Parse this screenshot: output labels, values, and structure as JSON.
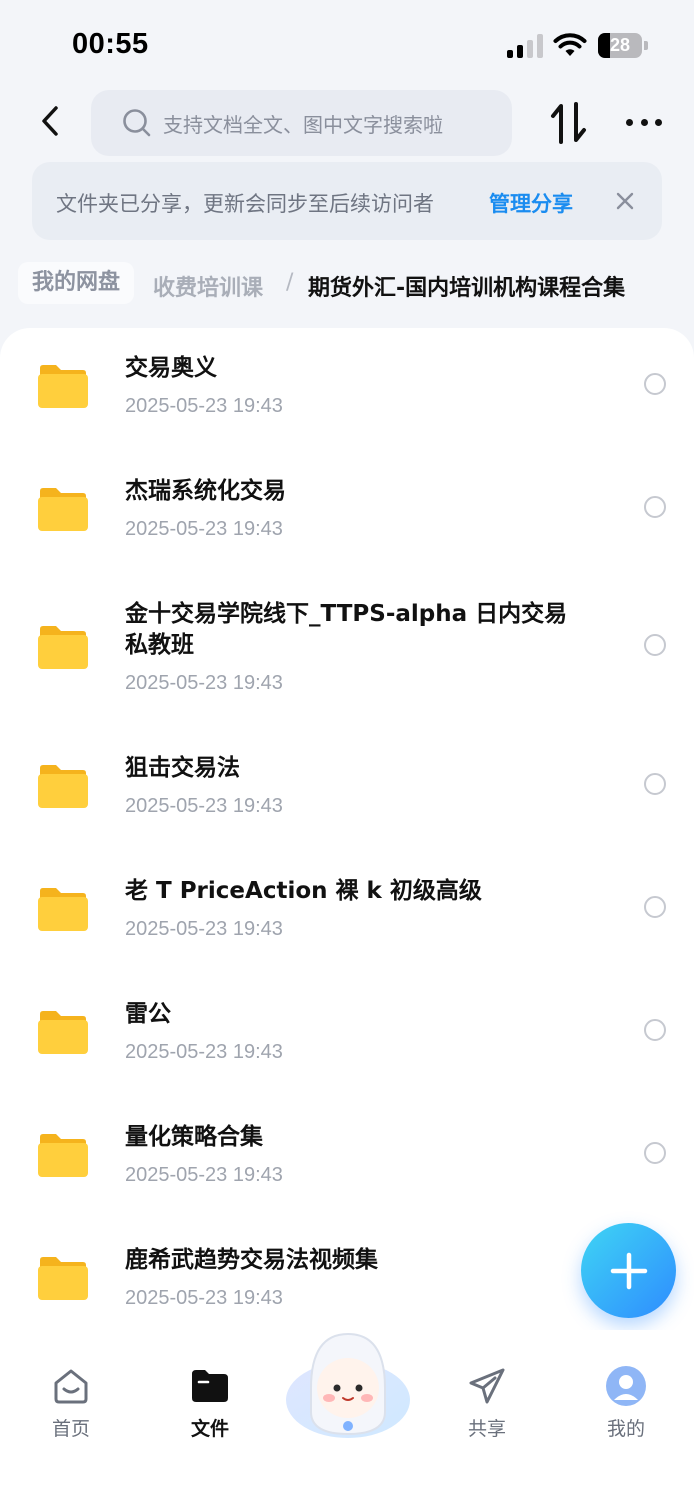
{
  "status_bar": {
    "time": "00:55",
    "battery": "28",
    "battery_level": 0.28
  },
  "toolbar": {
    "back_icon": "chevron-left-icon",
    "search_placeholder": "支持文档全文、图中文字搜索啦",
    "sort_icon": "sort-arrows-icon",
    "more_icon": "more-dots-icon"
  },
  "share_banner": {
    "message": "文件夹已分享，更新会同步至后续访问者",
    "link": "管理分享",
    "close_icon": "close-icon"
  },
  "breadcrumb": {
    "root": "我的网盘",
    "parent": "收费培训课",
    "separator": "/",
    "current": "期货外汇-国内培训机构课程合集"
  },
  "files": [
    {
      "name": "交易奥义",
      "date": "2025-05-23 19:43"
    },
    {
      "name": "杰瑞系统化交易",
      "date": "2025-05-23 19:43"
    },
    {
      "name": "金十交易学院线下_TTPS-alpha 日内交易私教班",
      "date": "2025-05-23 19:43"
    },
    {
      "name": "狙击交易法",
      "date": "2025-05-23 19:43"
    },
    {
      "name": "老 T PriceAction 裸 k 初级高级",
      "date": "2025-05-23 19:43"
    },
    {
      "name": "雷公",
      "date": "2025-05-23 19:43"
    },
    {
      "name": "量化策略合集",
      "date": "2025-05-23 19:43"
    },
    {
      "name": "鹿希武趋势交易法视频集",
      "date": "2025-05-23 19:43"
    }
  ],
  "fab": {
    "icon": "plus-icon"
  },
  "bottom_nav": [
    {
      "label": "首页",
      "icon": "home-icon",
      "active": false
    },
    {
      "label": "文件",
      "icon": "folder-icon",
      "active": true
    },
    {
      "label": "共享",
      "icon": "send-icon",
      "active": false
    },
    {
      "label": "我的",
      "icon": "avatar-icon",
      "active": false
    }
  ],
  "colors": {
    "accent": "#1a8cf0",
    "folder": "#ffc53d",
    "background": "#f3f5f9"
  }
}
